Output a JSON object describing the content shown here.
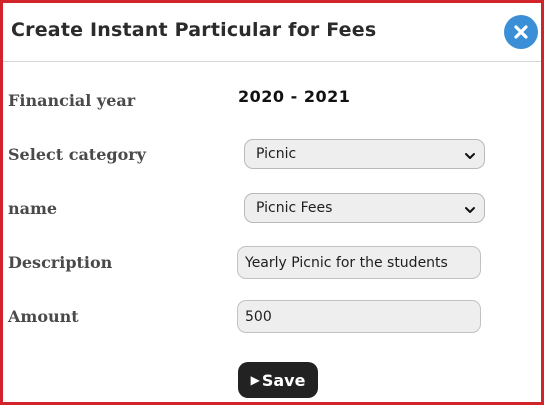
{
  "modal": {
    "title": "Create Instant Particular for Fees",
    "close_icon": "close-icon",
    "accent_color": "#3a8fd6",
    "border_color": "#d2232a"
  },
  "form": {
    "financial_year": {
      "label": "Financial year",
      "value": "2020 - 2021"
    },
    "category": {
      "label": "Select category",
      "selected": "Picnic",
      "icon": "chevron-down-icon"
    },
    "name": {
      "label": "name",
      "selected": "Picnic Fees",
      "icon": "chevron-down-icon"
    },
    "description": {
      "label": "Description",
      "value": "Yearly Picnic for the students"
    },
    "amount": {
      "label": "Amount",
      "value": "500"
    }
  },
  "actions": {
    "save": {
      "icon": "▶",
      "label": "Save"
    }
  }
}
